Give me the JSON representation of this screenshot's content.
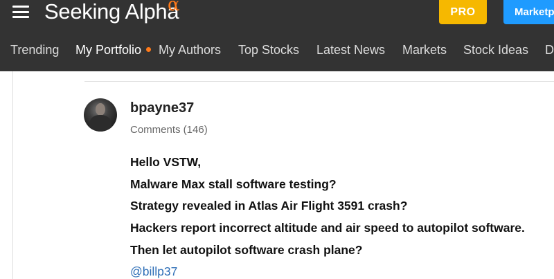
{
  "header": {
    "logo_text": "Seeking Alpha",
    "logo_symbol": "α",
    "pro_label": "PRO",
    "market_label": "Marketplace",
    "nav": [
      {
        "label": "Trending"
      },
      {
        "label": "My Portfolio"
      },
      {
        "label": "My Authors"
      },
      {
        "label": "Top Stocks"
      },
      {
        "label": "Latest News"
      },
      {
        "label": "Markets"
      },
      {
        "label": "Stock Ideas"
      },
      {
        "label": "D"
      }
    ]
  },
  "comment": {
    "username": "bpayne37",
    "comments_count": "Comments (146)",
    "lines": [
      "Hello VSTW,",
      "Malware Max stall software testing?",
      "Strategy revealed in Atlas Air Flight 3591 crash?",
      "Hackers report incorrect altitude and air speed to autopilot software.",
      "Then let autopilot software crash plane?"
    ],
    "mention": "@billp37"
  },
  "colors": {
    "header_bg": "#333333",
    "pro_bg": "#f6b800",
    "market_bg": "#1f9bff",
    "notification_dot": "#ff7a1a",
    "link": "#2f6fb7"
  }
}
